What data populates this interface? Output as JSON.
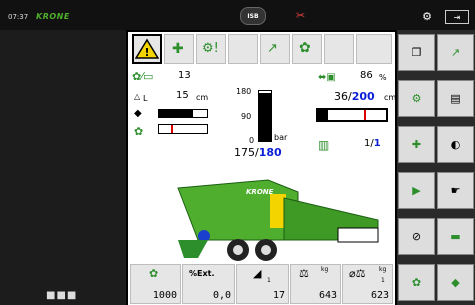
{
  "topbar": {
    "time": "07:37",
    "brand": "KRONE",
    "center_badge": "ISB",
    "gear_icon": "gear-icon",
    "exit_icon": "exit-icon"
  },
  "left_panel": {
    "menu_dots": "■■■"
  },
  "status": {
    "bales_count": "13",
    "length_label": "L",
    "length_value": "15",
    "length_unit": "cm",
    "pressure_scale": [
      "180",
      "90",
      "0"
    ],
    "pressure_unit": "bar",
    "pressure_actual": "175",
    "pressure_target": "180",
    "knotter_percent": "86",
    "percent_unit": "%",
    "bale_length_actual": "36",
    "bale_length_target": "200",
    "bale_length_unit": "cm",
    "layers_actual": "1",
    "layers_target": "1",
    "pressure_bar_fraction": 0.97
  },
  "counters": [
    {
      "name": "total-bales",
      "label": "",
      "value": "1000"
    },
    {
      "name": "ext-percent",
      "label": "%Ext.",
      "value": "0,0"
    },
    {
      "name": "knife-count",
      "label": "",
      "sub": "1",
      "value": "17"
    },
    {
      "name": "bale-weight",
      "label": "kg",
      "value": "643"
    },
    {
      "name": "avg-weight",
      "label": "kg",
      "sub": "1",
      "value": "623"
    }
  ],
  "colors": {
    "krone_green": "#4fae2e",
    "target_blue": "#0b1fd6",
    "warning_yellow": "#f4d400"
  }
}
